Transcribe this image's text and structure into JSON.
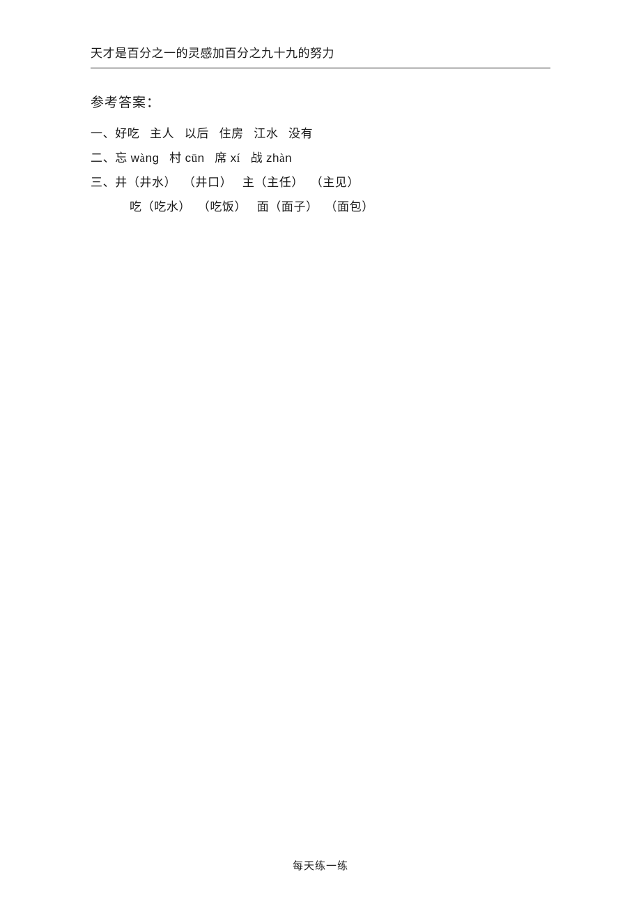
{
  "header": {
    "motto": "天才是百分之一的灵感加百分之九十九的努力"
  },
  "answers": {
    "title": "参考答案：",
    "section1": {
      "label": "一、",
      "items": [
        "好吃",
        "主人",
        "以后",
        "住房",
        "江水",
        "没有"
      ]
    },
    "section2": {
      "label": "二、",
      "items": [
        {
          "ch": "忘",
          "pinyin_pre": "w",
          "pinyin_accent": "à",
          "pinyin_post": "ng"
        },
        {
          "ch": "村",
          "pinyin_pre": "c",
          "pinyin_accent": "ū",
          "pinyin_post": "n"
        },
        {
          "ch": "席",
          "pinyin_pre": "x",
          "pinyin_accent": "í",
          "pinyin_post": ""
        },
        {
          "ch": "战",
          "pinyin_pre": "zh",
          "pinyin_accent": "à",
          "pinyin_post": "n"
        }
      ]
    },
    "section3": {
      "label": "三、",
      "row1": [
        {
          "head": "井",
          "w1": "井水",
          "w2": "井口"
        },
        {
          "head": "主",
          "w1": "主任",
          "w2": "主见"
        }
      ],
      "row2": [
        {
          "head": "吃",
          "w1": "吃水",
          "w2": "吃饭"
        },
        {
          "head": "面",
          "w1": "面子",
          "w2": "面包"
        }
      ]
    }
  },
  "footer": {
    "text": "每天练一练"
  }
}
